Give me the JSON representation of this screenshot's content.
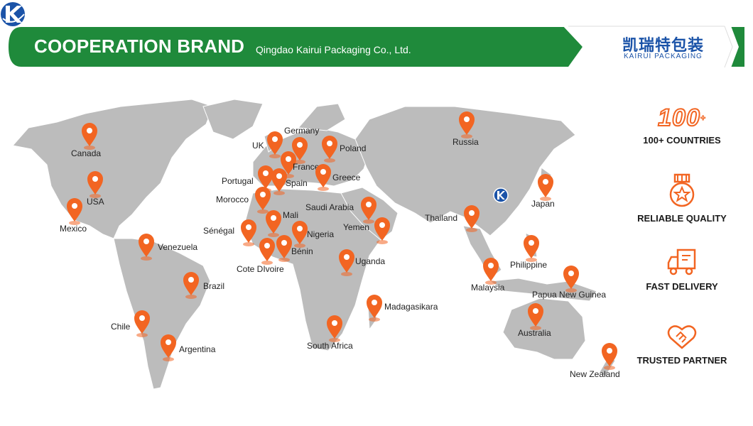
{
  "header": {
    "title": "COOPERATION BRAND",
    "company": "Qingdao Kairui Packaging Co., Ltd.",
    "logo_cn": "凯瑞特包装",
    "logo_en": "KAIRUI PACKAGING"
  },
  "colors": {
    "banner_green": "#1f8a3b",
    "banner_dark_green": "#136a2a",
    "marker_orange": "#f26522",
    "land_gray": "#bcbcbc",
    "brand_blue": "#1b53a8"
  },
  "countries": [
    {
      "name": "Canada"
    },
    {
      "name": "USA"
    },
    {
      "name": "Mexico"
    },
    {
      "name": "Venezuela"
    },
    {
      "name": "Brazil"
    },
    {
      "name": "Chile"
    },
    {
      "name": "Argentina"
    },
    {
      "name": "UK"
    },
    {
      "name": "Germany"
    },
    {
      "name": "Poland"
    },
    {
      "name": "France"
    },
    {
      "name": "Portugal"
    },
    {
      "name": "Spain"
    },
    {
      "name": "Greece"
    },
    {
      "name": "Morocco"
    },
    {
      "name": "Saudi Arabia"
    },
    {
      "name": "Mali"
    },
    {
      "name": "Sénégal"
    },
    {
      "name": "Nigeria"
    },
    {
      "name": "Yemen"
    },
    {
      "name": "Bénin"
    },
    {
      "name": "Cote DIvoire"
    },
    {
      "name": "Uganda"
    },
    {
      "name": "Madagasikara"
    },
    {
      "name": "South Africa"
    },
    {
      "name": "Russia"
    },
    {
      "name": "Thailand"
    },
    {
      "name": "Japan"
    },
    {
      "name": "Philippine"
    },
    {
      "name": "Malaysia"
    },
    {
      "name": "Papua New Guinea"
    },
    {
      "name": "Australia"
    },
    {
      "name": "New Zealand"
    }
  ],
  "features": [
    {
      "headline": "100",
      "sup": "+",
      "label": "100+ COUNTRIES",
      "icon": "hundred-badge-icon"
    },
    {
      "label": "RELIABLE QUALITY",
      "icon": "medal-icon"
    },
    {
      "label": "FAST DELIVERY",
      "icon": "truck-icon"
    },
    {
      "label": "TRUSTED PARTNER",
      "icon": "handshake-icon"
    }
  ]
}
